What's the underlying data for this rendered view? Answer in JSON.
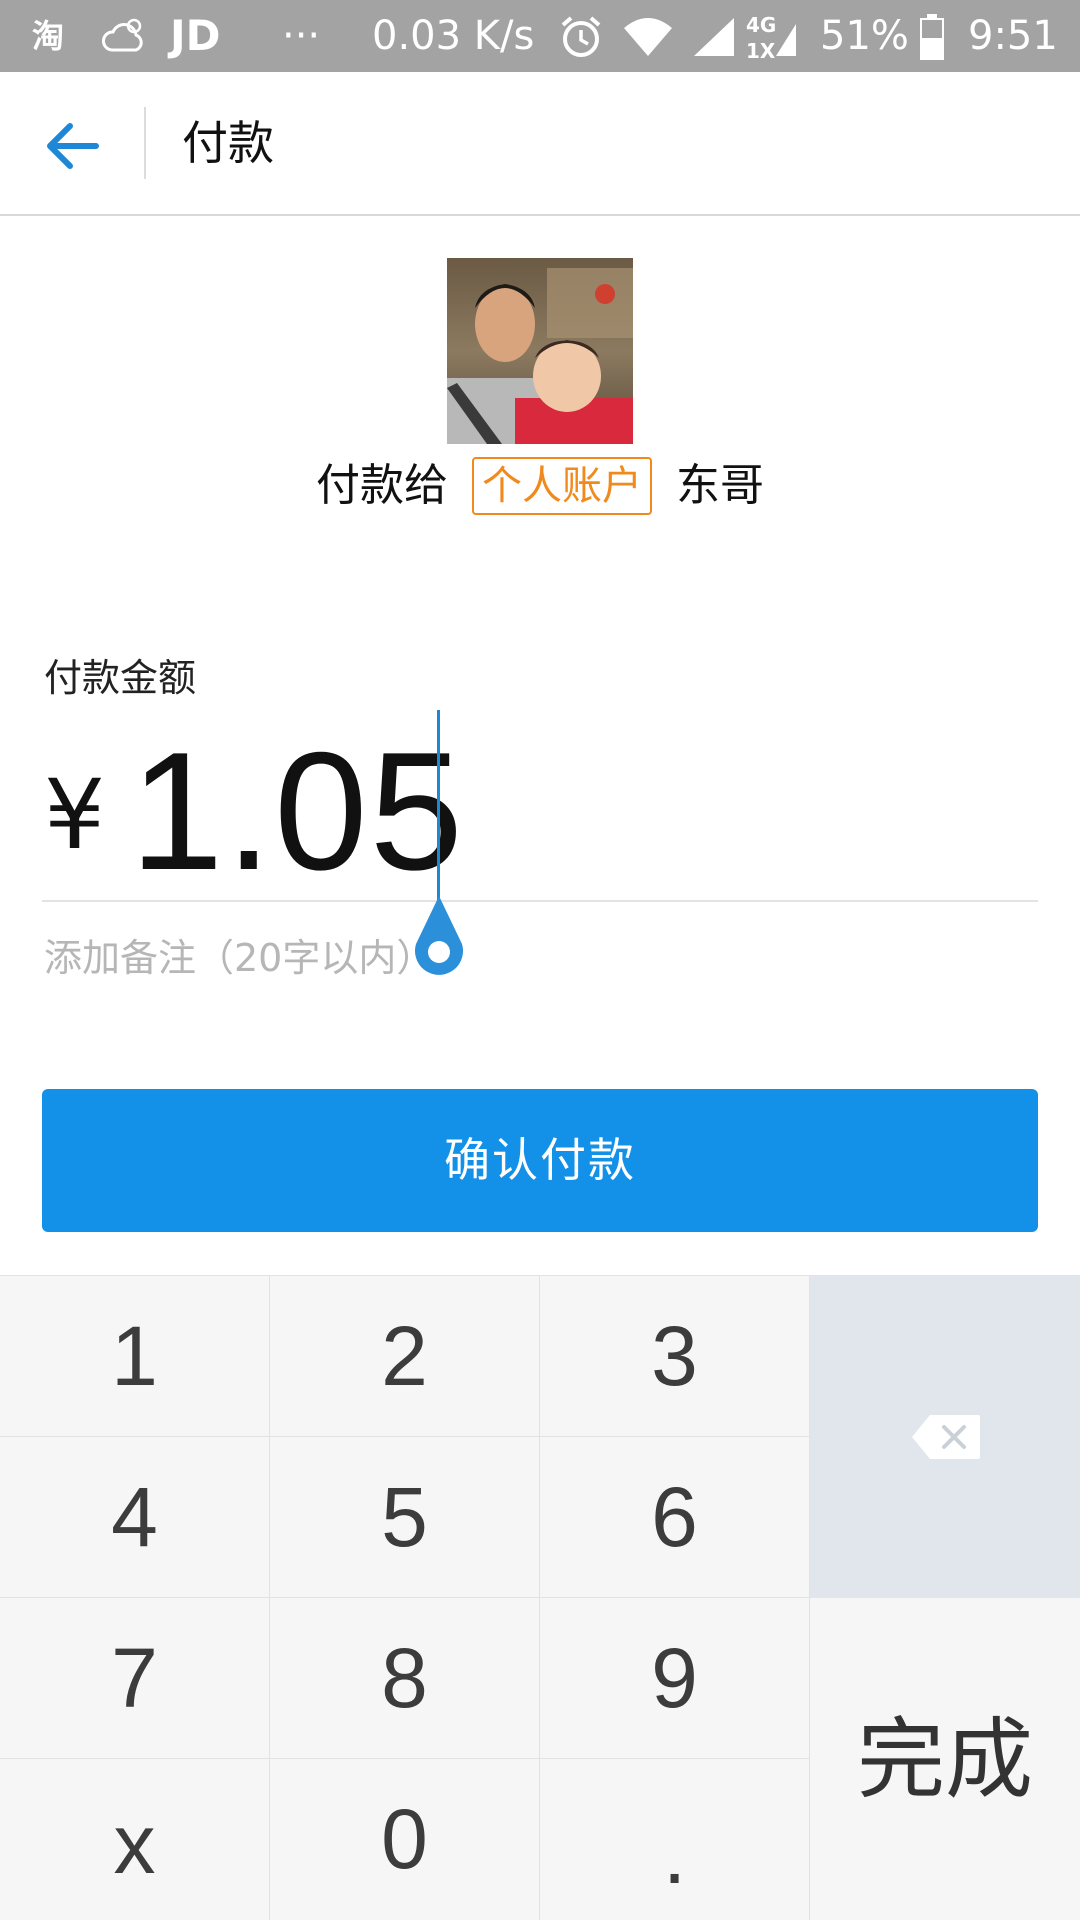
{
  "status_bar": {
    "taobao": "淘",
    "jd": "JD",
    "more": "···",
    "net_speed": "0.03 K/s",
    "net_type_top": "4G",
    "net_type_bottom": "1X",
    "battery": "51%",
    "time": "9:51"
  },
  "header": {
    "title": "付款"
  },
  "payee": {
    "prefix": "付款给",
    "account_type": "个人账户",
    "name": "东哥"
  },
  "amount": {
    "label": "付款金额",
    "currency": "¥",
    "value": "1.05"
  },
  "remark": {
    "placeholder": "添加备注（20字以内）"
  },
  "confirm_button": {
    "label": "确认付款"
  },
  "keypad": {
    "keys": [
      "1",
      "2",
      "3",
      "4",
      "5",
      "6",
      "7",
      "8",
      "9",
      "x",
      "0",
      "."
    ],
    "done": "完成"
  },
  "colors": {
    "accent": "#1390e8",
    "tag": "#f08a1c",
    "status_bar": "#a3a3a3"
  }
}
